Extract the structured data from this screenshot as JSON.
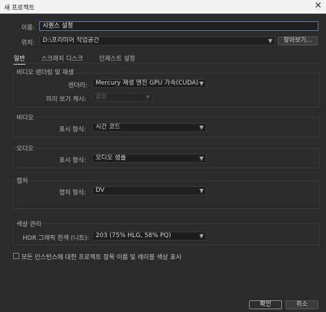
{
  "window": {
    "title": "새 프로젝트",
    "close_glyph": "✕"
  },
  "name": {
    "label": "이름:",
    "value": "시퀀스 설정"
  },
  "location": {
    "label": "위치:",
    "value": "D:\\프리미어 작업공간",
    "browse_label": "찾아보기..."
  },
  "tabs": [
    {
      "label": "일반",
      "active": true
    },
    {
      "label": "스크래치 디스크",
      "active": false
    },
    {
      "label": "인제스트 설정",
      "active": false
    }
  ],
  "sections": {
    "video_render": {
      "title": "비디오 렌더링 및 재생",
      "renderer_label": "렌더러:",
      "renderer_value": "Mercury 재생 엔진 GPU 가속(CUDA)",
      "preview_cache_label": "미리 보기 캐시:",
      "preview_cache_value": "없음"
    },
    "video": {
      "title": "비디오",
      "display_format_label": "표시 형식:",
      "display_format_value": "시간 코드"
    },
    "audio": {
      "title": "오디오",
      "display_format_label": "표시 형식:",
      "display_format_value": "오디오 샘플"
    },
    "capture": {
      "title": "캡처",
      "format_label": "캡처 형식:",
      "format_value": "DV"
    },
    "color": {
      "title": "색상 관리",
      "hdr_label": "HDR 그래픽 흰색 (니트):",
      "hdr_value": "203 (75% HLG, 58% PQ)"
    }
  },
  "checkbox": {
    "label": "모든 인스턴스에 대한 프로젝트 항목 이름 및 레이블 색상 표시",
    "checked": false
  },
  "footer": {
    "ok_label": "확인",
    "cancel_label": "취소"
  },
  "icons": {
    "dropdown": "chevron-down-icon"
  }
}
